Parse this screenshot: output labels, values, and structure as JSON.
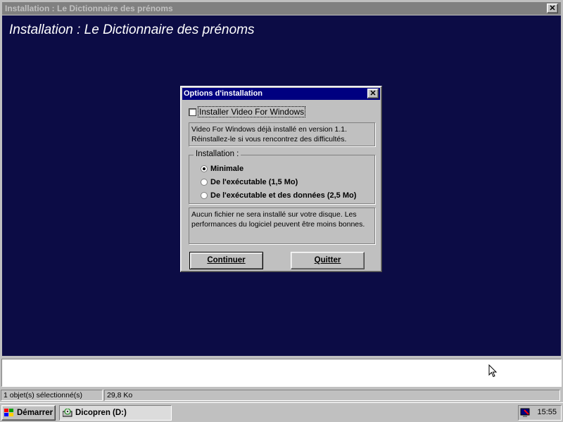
{
  "main_window": {
    "title": "Installation : Le Dictionnaire des prénoms",
    "heading": "Installation : Le Dictionnaire des prénoms",
    "close_icon": "close-icon"
  },
  "dialog": {
    "title": "Options d'installation",
    "close_icon": "close-icon",
    "checkbox": {
      "label": "Installer Video For Windows",
      "checked": false
    },
    "info_top": [
      "Video For Windows déjà installé en version 1.1.",
      "Réinstallez-le si vous rencontrez des difficultés."
    ],
    "group_label": "Installation :",
    "options": [
      {
        "label": "Minimale",
        "selected": true
      },
      {
        "label": "De l'exécutable (1,5 Mo)",
        "selected": false
      },
      {
        "label": "De l'exécutable et des données (2,5 Mo)",
        "selected": false
      }
    ],
    "info_bottom": [
      "Aucun fichier ne sera installé sur votre disque. Les",
      "performances du logiciel peuvent être moins bonnes."
    ],
    "continue_label": "Continuer",
    "quit_label": "Quitter"
  },
  "statusbar": {
    "selection": "1 objet(s) sélectionné(s)",
    "size": "29,8 Ko"
  },
  "taskbar": {
    "start_label": "Démarrer",
    "task_label": "Dicopren (D:)",
    "clock": "15:55"
  },
  "colors": {
    "desktop_bg": "#0c0c45",
    "active_title": "#000080",
    "inactive_title": "#808080",
    "face": "#c0c0c0"
  }
}
